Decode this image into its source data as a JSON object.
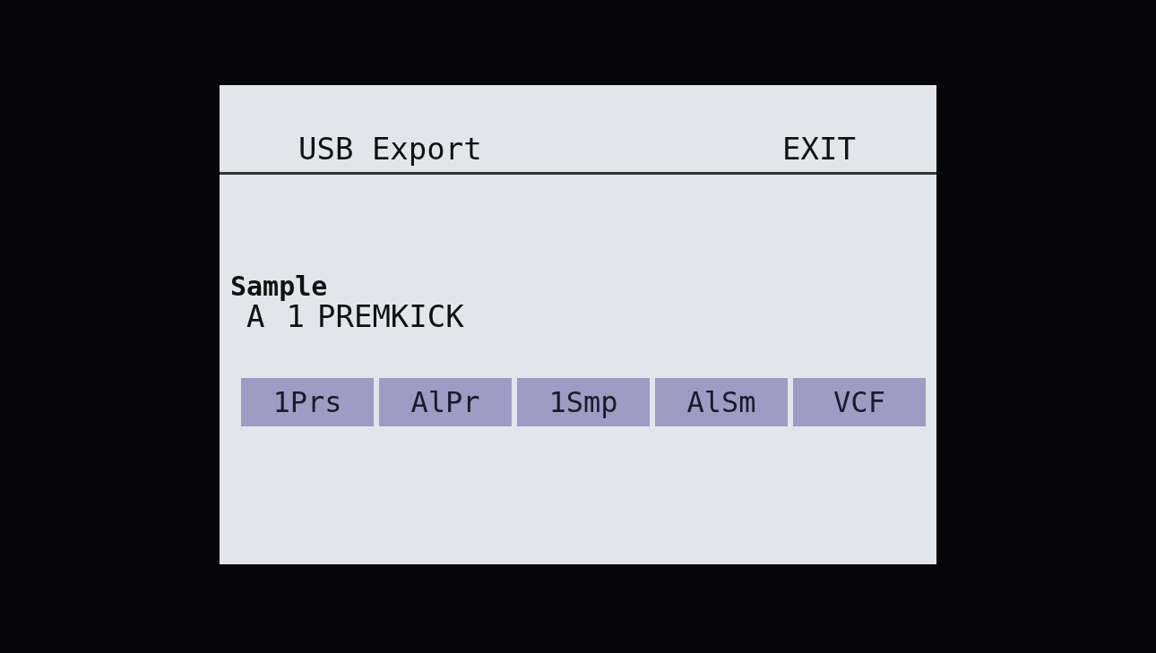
{
  "header": {
    "title": "USB Export",
    "action": "EXIT"
  },
  "parameter": {
    "label": "Sample",
    "bank": "A",
    "number": "1",
    "name": "PREMKICK"
  },
  "soft_keys": [
    {
      "label": "1Prs"
    },
    {
      "label": "AlPr"
    },
    {
      "label": "1Smp"
    },
    {
      "label": "AlSm"
    },
    {
      "label": "VCF"
    }
  ]
}
